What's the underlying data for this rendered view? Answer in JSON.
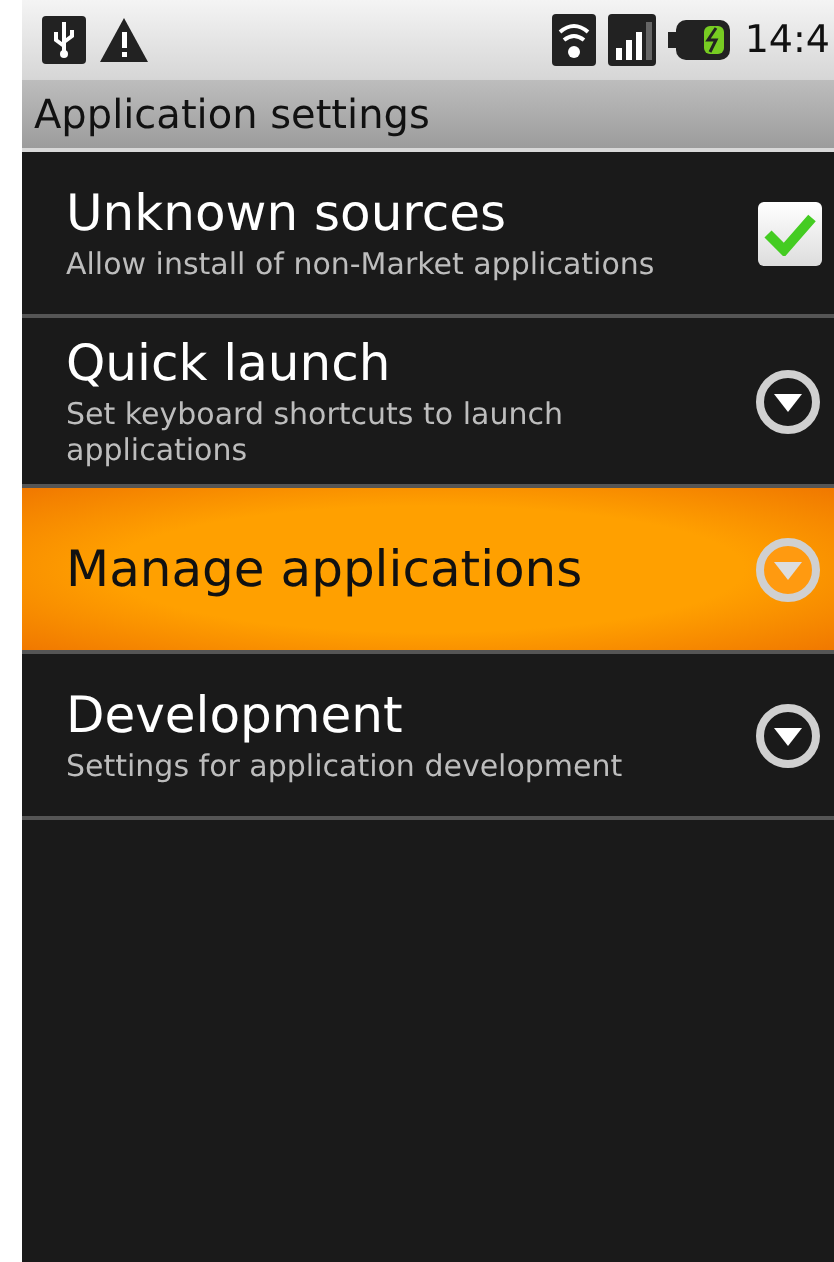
{
  "status_bar": {
    "time": "14:4"
  },
  "title_bar": {
    "title": "Application settings"
  },
  "items": [
    {
      "kind": "checkbox",
      "title": "Unknown sources",
      "summary": "Allow install of non-Market applications",
      "checked": true,
      "selected": false
    },
    {
      "kind": "more",
      "title": "Quick launch",
      "summary": "Set keyboard shortcuts to launch applications",
      "selected": false
    },
    {
      "kind": "more",
      "title": "Manage applications",
      "selected": true
    },
    {
      "kind": "more",
      "title": "Development",
      "summary": "Settings for application development",
      "selected": false
    }
  ]
}
